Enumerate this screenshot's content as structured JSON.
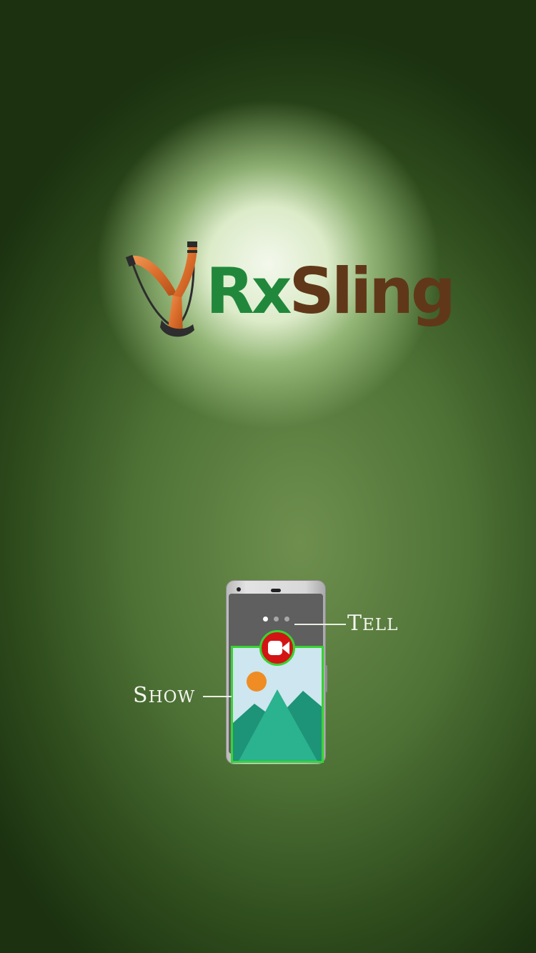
{
  "logo": {
    "icon": "slingshot-icon",
    "word_part1": "Rx",
    "word_part2": "Sling",
    "colors": {
      "rx": "#21883b",
      "sling": "#603819",
      "slingshot_wood": "#e07a3a"
    }
  },
  "illustration": {
    "icon": "phone-illustration",
    "record_icon": "video-camera-icon",
    "image_icon": "landscape-image-icon",
    "pager_dots": 3,
    "active_dot": 0,
    "highlight_color": "#37d431",
    "record_color": "#d41414",
    "callouts": {
      "tell": {
        "first": "T",
        "rest": "ELL"
      },
      "show": {
        "first": "S",
        "rest": "HOW"
      }
    }
  }
}
